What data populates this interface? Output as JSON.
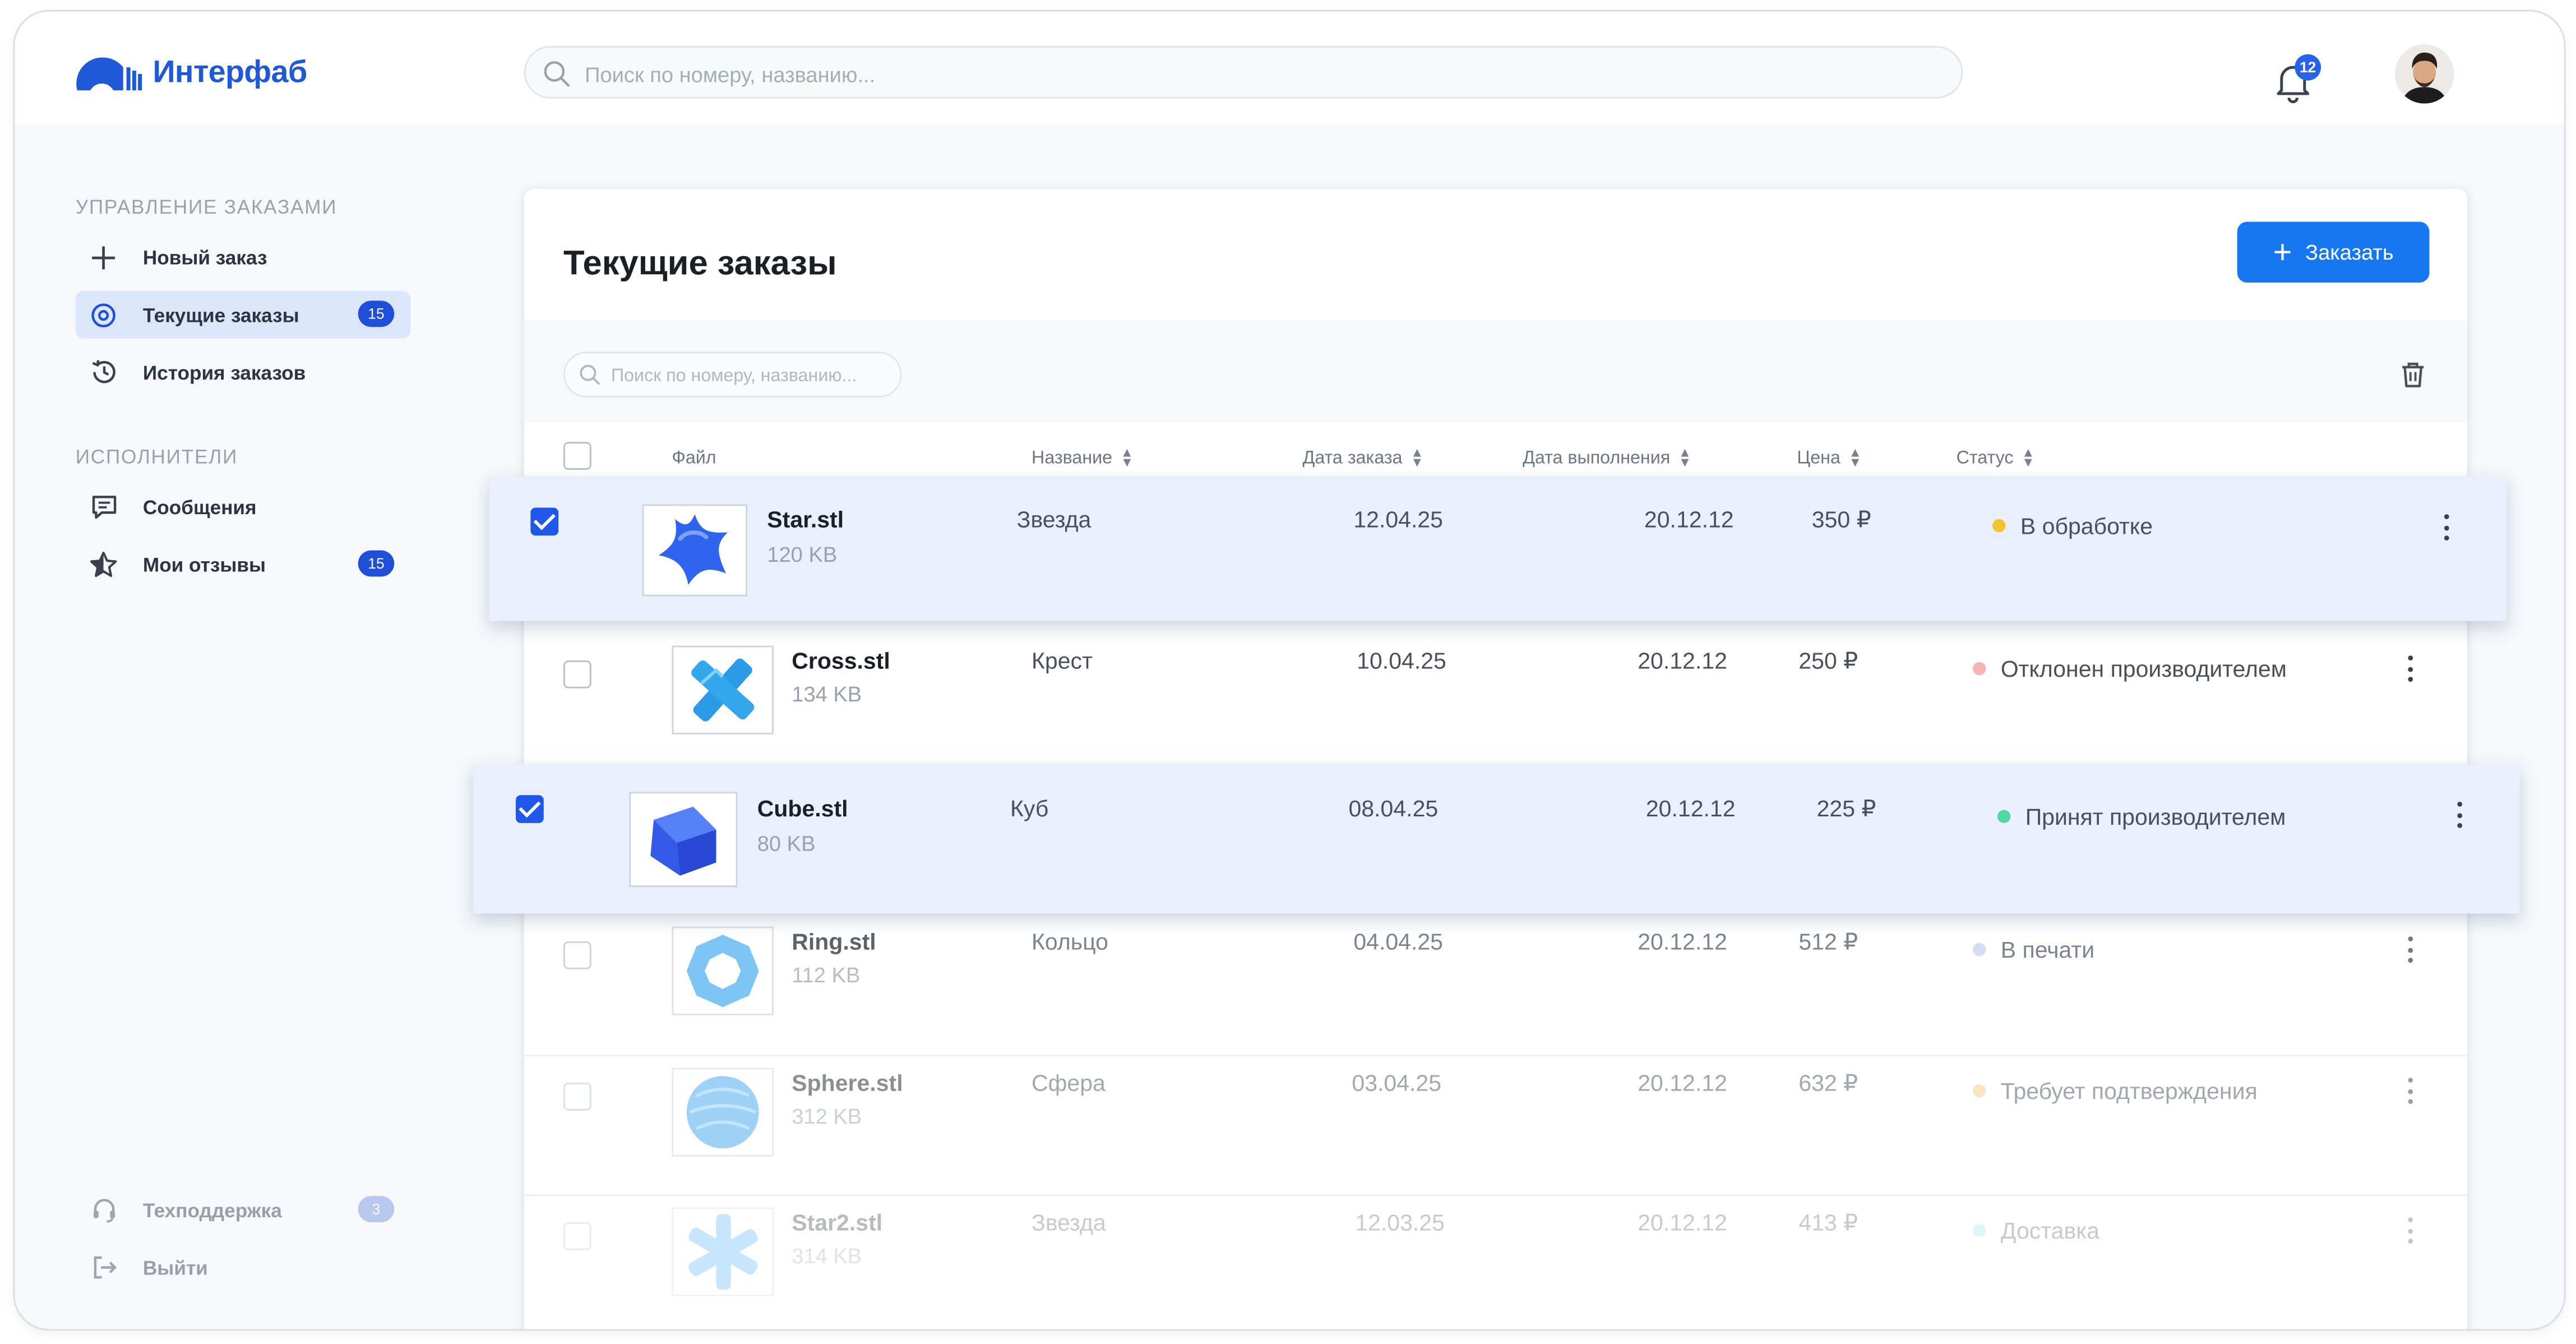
{
  "app": {
    "name": "Интерфаб",
    "brand_color": "#1f59d8",
    "accent_color": "#1677f0"
  },
  "topbar": {
    "search_placeholder": "Поиск по номеру, названию...",
    "notifications_count": "12"
  },
  "sidebar": {
    "sections": [
      {
        "title": "Управление заказами",
        "items": [
          {
            "label": "Новый заказ",
            "icon": "plus-icon"
          },
          {
            "label": "Текущие заказы",
            "icon": "target-icon",
            "badge": "15",
            "active": true
          },
          {
            "label": "История заказов",
            "icon": "history-icon"
          }
        ]
      },
      {
        "title": "Исполнители",
        "items": [
          {
            "label": "Сообщения",
            "icon": "message-icon"
          },
          {
            "label": "Мои отзывы",
            "icon": "star-half-icon",
            "badge": "15"
          }
        ]
      }
    ],
    "footer": [
      {
        "label": "Техподдержка",
        "icon": "headset-icon",
        "badge": "3"
      },
      {
        "label": "Выйти",
        "icon": "logout-icon"
      }
    ]
  },
  "main": {
    "title": "Текущие заказы",
    "order_button": "Заказать",
    "search_placeholder": "Поиск по номеру, названию...",
    "columns": [
      "Файл",
      "Название",
      "Дата заказа",
      "Дата выполнения",
      "Цена",
      "Статус"
    ],
    "rows": [
      {
        "file": "Star.stl",
        "size": "120 KB",
        "name": "Звезда",
        "order_date": "12.04.25",
        "due_date": "20.12.12",
        "price": "350 ₽",
        "status": "В обработке",
        "status_color": "#f2c230",
        "selected": true,
        "shape": "star"
      },
      {
        "file": "Cross.stl",
        "size": "134 KB",
        "name": "Крест",
        "order_date": "10.04.25",
        "due_date": "20.12.12",
        "price": "250 ₽",
        "status": "Отклонен производителем",
        "status_color": "#f47a7a",
        "selected": false,
        "shape": "cross"
      },
      {
        "file": "Cube.stl",
        "size": "80 KB",
        "name": "Куб",
        "order_date": "08.04.25",
        "due_date": "20.12.12",
        "price": "225 ₽",
        "status": "Принят производителем",
        "status_color": "#4fd9a4",
        "selected": true,
        "shape": "cube"
      },
      {
        "file": "Ring.stl",
        "size": "112 KB",
        "name": "Кольцо",
        "order_date": "04.04.25",
        "due_date": "20.12.12",
        "price": "512 ₽",
        "status": "В печати",
        "status_color": "#a9b8f2",
        "selected": false,
        "shape": "ring"
      },
      {
        "file": "Sphere.stl",
        "size": "312 KB",
        "name": "Сфера",
        "order_date": "03.04.25",
        "due_date": "20.12.12",
        "price": "632 ₽",
        "status": "Требует подтверждения",
        "status_color": "#f7c98a",
        "selected": false,
        "shape": "sphere"
      },
      {
        "file": "Star2.stl",
        "size": "314 KB",
        "name": "Звезда",
        "order_date": "12.03.25",
        "due_date": "20.12.12",
        "price": "413 ₽",
        "status": "Доставка",
        "status_color": "#8fe3e8",
        "selected": false,
        "shape": "star2"
      }
    ]
  }
}
